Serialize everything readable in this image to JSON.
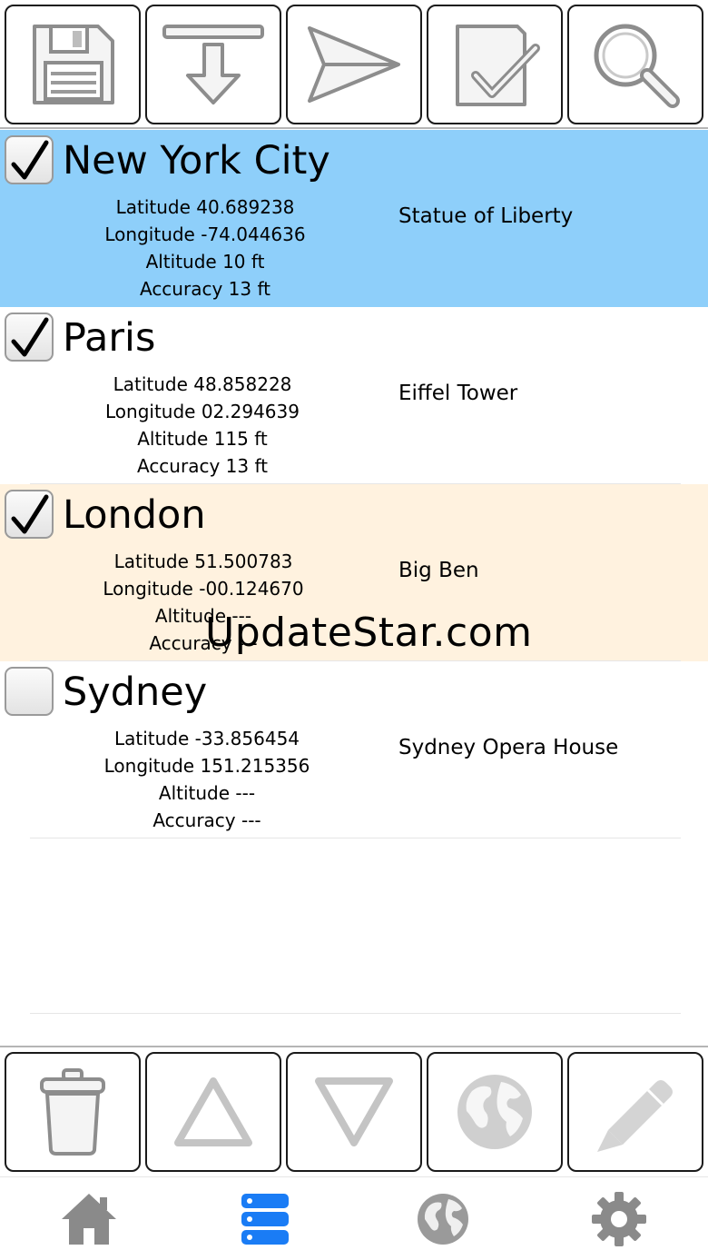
{
  "top_toolbar": {
    "buttons": [
      {
        "icon": "floppy-disk-icon"
      },
      {
        "icon": "download-arrow-icon"
      },
      {
        "icon": "send-paper-plane-icon"
      },
      {
        "icon": "checkbox-checked-icon"
      },
      {
        "icon": "magnifier-search-icon"
      }
    ]
  },
  "locations": [
    {
      "city": "New York City",
      "checked": true,
      "landmark": "Statue of Liberty",
      "latitude": "Latitude 40.689238",
      "longitude": "Longitude -74.044636",
      "altitude": "Altitude 10 ft",
      "accuracy": "Accuracy 13 ft",
      "highlight": "#8ecffa"
    },
    {
      "city": "Paris",
      "checked": true,
      "landmark": "Eiffel Tower",
      "latitude": "Latitude 48.858228",
      "longitude": "Longitude 02.294639",
      "altitude": "Altitude 115 ft",
      "accuracy": "Accuracy 13 ft",
      "highlight": "#ffffff"
    },
    {
      "city": "London",
      "checked": true,
      "landmark": "Big Ben",
      "latitude": "Latitude 51.500783",
      "longitude": "Longitude -00.124670",
      "altitude": "Altitude ---",
      "accuracy": "Accuracy ---",
      "highlight": "#fff2df"
    },
    {
      "city": "Sydney",
      "checked": false,
      "landmark": "Sydney Opera House",
      "latitude": "Latitude -33.856454",
      "longitude": "Longitude 151.215356",
      "altitude": "Altitude ---",
      "accuracy": "Accuracy ---",
      "highlight": "#ffffff"
    }
  ],
  "watermark": "UpdateStar.com",
  "bottom_toolbar": {
    "buttons": [
      {
        "icon": "trash-can-icon"
      },
      {
        "icon": "move-up-triangle-icon"
      },
      {
        "icon": "move-down-triangle-icon"
      },
      {
        "icon": "globe-icon"
      },
      {
        "icon": "pencil-edit-icon"
      }
    ]
  },
  "tab_bar": {
    "tabs": [
      {
        "icon": "home-icon",
        "active": false
      },
      {
        "icon": "list-database-icon",
        "active": true
      },
      {
        "icon": "globe-icon",
        "active": false
      },
      {
        "icon": "gear-icon",
        "active": false
      }
    ],
    "active_color": "#1a7cf5",
    "inactive_color": "#8a8a8a"
  }
}
